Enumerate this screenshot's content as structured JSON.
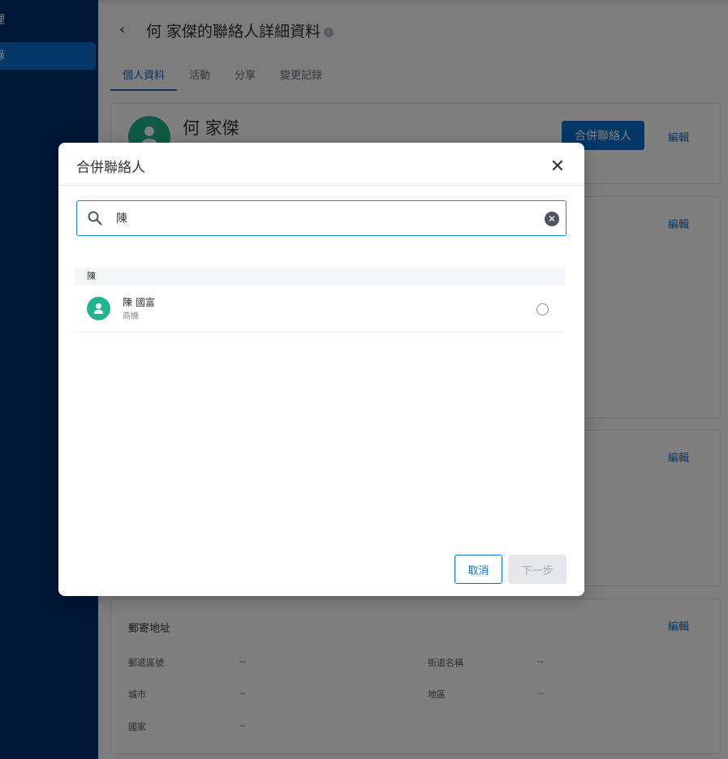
{
  "sidebar": {
    "items": [
      {
        "label": "理"
      },
      {
        "label": "錄"
      }
    ]
  },
  "header": {
    "title": "何 家傑的聯絡人詳細資料"
  },
  "tabs": [
    {
      "label": "個人資料"
    },
    {
      "label": "活動"
    },
    {
      "label": "分享"
    },
    {
      "label": "變更記錄"
    }
  ],
  "profile": {
    "name": "何 家傑",
    "merge_label": "合併聯絡人",
    "edit_label": "編輯"
  },
  "mailing_address": {
    "title": "郵寄地址",
    "fields": [
      {
        "label": "郵遞區號",
        "value": "--"
      },
      {
        "label": "街道名稱",
        "value": "--"
      },
      {
        "label": "城市",
        "value": "--"
      },
      {
        "label": "地區",
        "value": "--"
      },
      {
        "label": "國家",
        "value": "--"
      }
    ]
  },
  "modal": {
    "title": "合併聯絡人",
    "search_value": "陳",
    "group_header": "陳",
    "results": [
      {
        "name": "陳 國富",
        "type": "商機"
      }
    ],
    "cancel_label": "取消",
    "next_label": "下一步"
  },
  "colors": {
    "sidebar_bg": "#002f6c",
    "accent": "#0a6ed1",
    "avatar": "#1fb58f"
  }
}
